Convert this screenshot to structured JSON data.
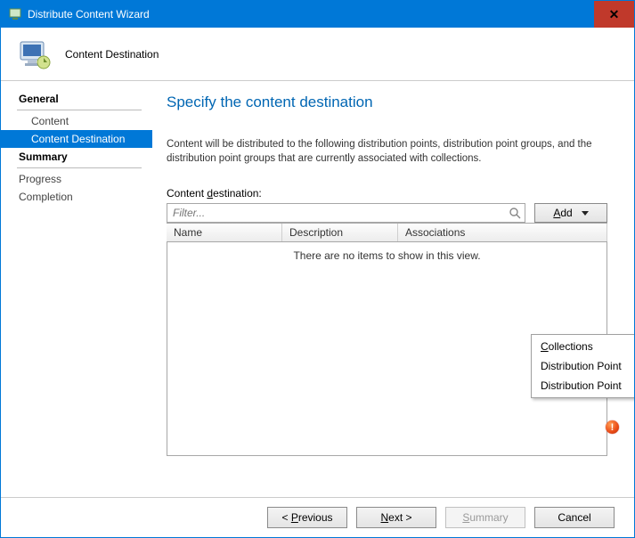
{
  "window": {
    "title": "Distribute Content Wizard"
  },
  "header": {
    "title": "Content Destination"
  },
  "nav": {
    "general": "General",
    "content": "Content",
    "content_dest": "Content Destination",
    "summary": "Summary",
    "progress": "Progress",
    "completion": "Completion"
  },
  "page": {
    "heading": "Specify the content destination",
    "intro": "Content will be distributed to the following distribution points, distribution point groups, and the distribution point groups that are currently associated with collections.",
    "field_label_pre": "Content ",
    "field_label_ul": "d",
    "field_label_post": "estination:",
    "filter_placeholder": "Filter...",
    "add_ul": "A",
    "add_post": "dd",
    "cols": {
      "name": "Name",
      "desc": "Description",
      "assoc": "Associations"
    },
    "empty": "There are no items to show in this view.",
    "menu": {
      "m1_ul": "C",
      "m1_post": "ollections",
      "m2": "Distribution Point",
      "m3": "Distribution Point"
    }
  },
  "footer": {
    "prev_pre": "< ",
    "prev_ul": "P",
    "prev_post": "revious",
    "next_ul": "N",
    "next_post": "ext >",
    "summary_ul": "S",
    "summary_post": "ummary",
    "cancel": "Cancel"
  }
}
